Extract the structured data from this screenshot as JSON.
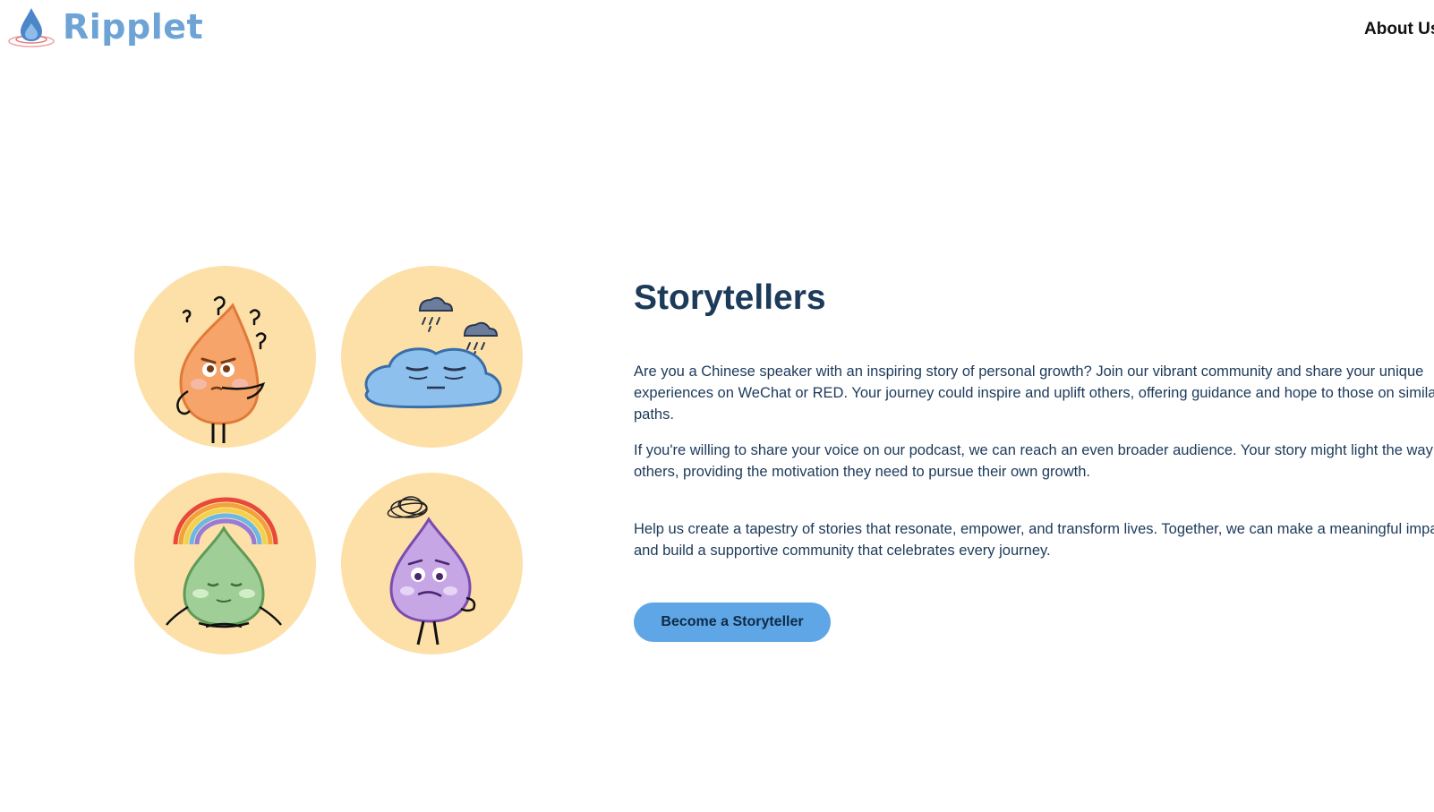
{
  "header": {
    "logo_text": "Ripplet",
    "nav": [
      {
        "label": "About Us"
      }
    ]
  },
  "illustrations": [
    {
      "name": "confused-orange-droplet",
      "color": "#f7a46a"
    },
    {
      "name": "sad-blue-puddle",
      "color": "#8ec0ee"
    },
    {
      "name": "calm-green-droplet",
      "color": "#9fcf97"
    },
    {
      "name": "anxious-purple-droplet",
      "color": "#c7a6e6"
    }
  ],
  "storytellers": {
    "title": "Storytellers",
    "paragraphs": [
      "Are you a Chinese speaker with an inspiring story of personal growth? Join our vibrant community and share your unique experiences on WeChat or RED. Your journey could inspire and uplift others, offering guidance and hope to those on similar paths.",
      "If you're willing to share your voice on our podcast, we can reach an even broader audience. Your story might light the way for others, providing the motivation they need to pursue their own growth.",
      "Help us create a tapestry of stories that resonate, empower, and transform lives. Together, we can make a meaningful impact and build a supportive community that celebrates every journey."
    ],
    "cta_label": "Become a Storyteller"
  },
  "colors": {
    "accent": "#5ea6e6",
    "heading": "#1c3a5a",
    "circle_bg": "#fde0a8",
    "logo": "#6ea3d6"
  }
}
